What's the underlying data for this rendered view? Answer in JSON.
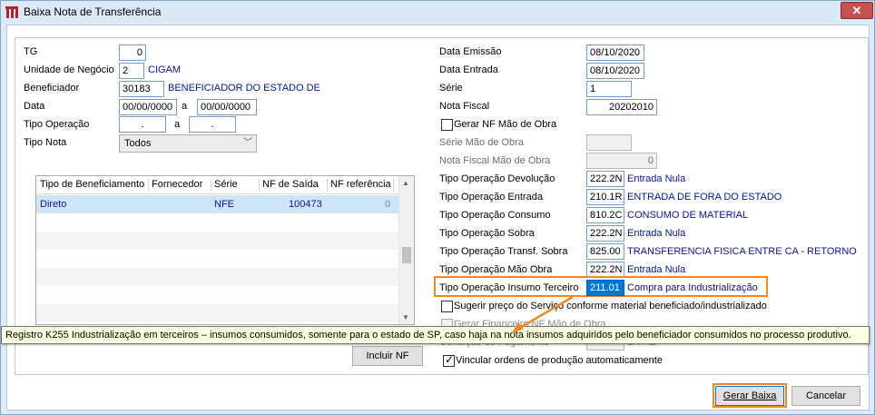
{
  "window": {
    "title": "Baixa Nota de Transferência",
    "close_symbol": "✕"
  },
  "left": {
    "tg": {
      "label": "TG",
      "value": "0"
    },
    "unidade": {
      "label": "Unidade de Negócio",
      "code": "2",
      "name": "CIGAM"
    },
    "beneficiador": {
      "label": "Beneficiador",
      "code": "30183",
      "name": "BENEFICIADOR DO ESTADO DE"
    },
    "data": {
      "label": "Data",
      "from": "00/00/0000",
      "sep": "a",
      "to": "00/00/0000"
    },
    "tipo_operacao": {
      "label": "Tipo Operação",
      "from": ".",
      "sep": "a",
      "to": "."
    },
    "tipo_nota": {
      "label": "Tipo Nota",
      "value": "Todos"
    }
  },
  "grid": {
    "columns": [
      "Tipo de Beneficiamento",
      "Fornecedor",
      "Série",
      "NF de Saída",
      "NF referência"
    ],
    "rows": [
      {
        "tipo": "Direto",
        "fornecedor": "",
        "serie": "NFE",
        "nf_saida": "100473",
        "nf_ref": "0"
      }
    ]
  },
  "right": {
    "data_emissao": {
      "label": "Data Emissão",
      "value": "08/10/2020"
    },
    "data_entrada": {
      "label": "Data Entrada",
      "value": "08/10/2020"
    },
    "serie": {
      "label": "Série",
      "value": "1"
    },
    "nota_fiscal": {
      "label": "Nota Fiscal",
      "value": "20202010"
    },
    "gerar_nf_mao_obra": {
      "label": "Gerar NF Mão de Obra",
      "checked": false
    },
    "serie_mao_obra": {
      "label": "Série Mão de Obra",
      "value": ""
    },
    "nf_mao_obra": {
      "label": "Nota Fiscal Mão de Obra",
      "value": "0"
    },
    "op_devolucao": {
      "label": "Tipo Operação Devolução",
      "code": "222.2N",
      "desc": "Entrada Nula"
    },
    "op_entrada": {
      "label": "Tipo Operação Entrada",
      "code": "210.1R",
      "desc": "ENTRADA DE FORA DO ESTADO"
    },
    "op_consumo": {
      "label": "Tipo Operação Consumo",
      "code": "810.2C",
      "desc": "CONSUMO DE MATERIAL"
    },
    "op_sobra": {
      "label": "Tipo Operação Sobra",
      "code": "222.2N",
      "desc": "Entrada Nula"
    },
    "op_transf_sobra": {
      "label": "Tipo Operação Transf. Sobra",
      "code": "825.00",
      "desc": "TRANSFERENCIA FISICA ENTRE CA - RETORNO"
    },
    "op_mao_obra": {
      "label": "Tipo Operação Mão Obra",
      "code": "222.2N",
      "desc": "Entrada Nula"
    },
    "op_insumo_terceiro": {
      "label": "Tipo Operação Insumo Terceiro",
      "code": "211.01",
      "desc": "Compra para Industrialização"
    },
    "sugerir_preco": {
      "label": "Sugerir preço do Serviço conforme material beneficiado/industrializado",
      "checked": false
    },
    "gerar_financeiro": {
      "label": "Gerar Financeiro NF Mão de Obra",
      "checked": false
    },
    "condicao_pagamento": {
      "label": "Condição de Pagamento",
      "desc": "LIVRE"
    },
    "vincular_ordens": {
      "label": "Vincular ordens de produção automaticamente",
      "checked": true
    }
  },
  "tooltip": "Registro K255 Industrialização em terceiros – insumos consumidos, somente para o estado de SP, caso haja na nota insumos adquiridos pelo beneficiador consumidos no processo produtivo.",
  "buttons": {
    "incluir_nf": "Incluir NF",
    "gerar_baixa": "Gerar Baixa",
    "cancelar": "Cancelar"
  },
  "colors": {
    "highlight": "#f08a24",
    "link_text": "#10109a",
    "selected_row": "#cde5f7",
    "close_button": "#c75050"
  }
}
